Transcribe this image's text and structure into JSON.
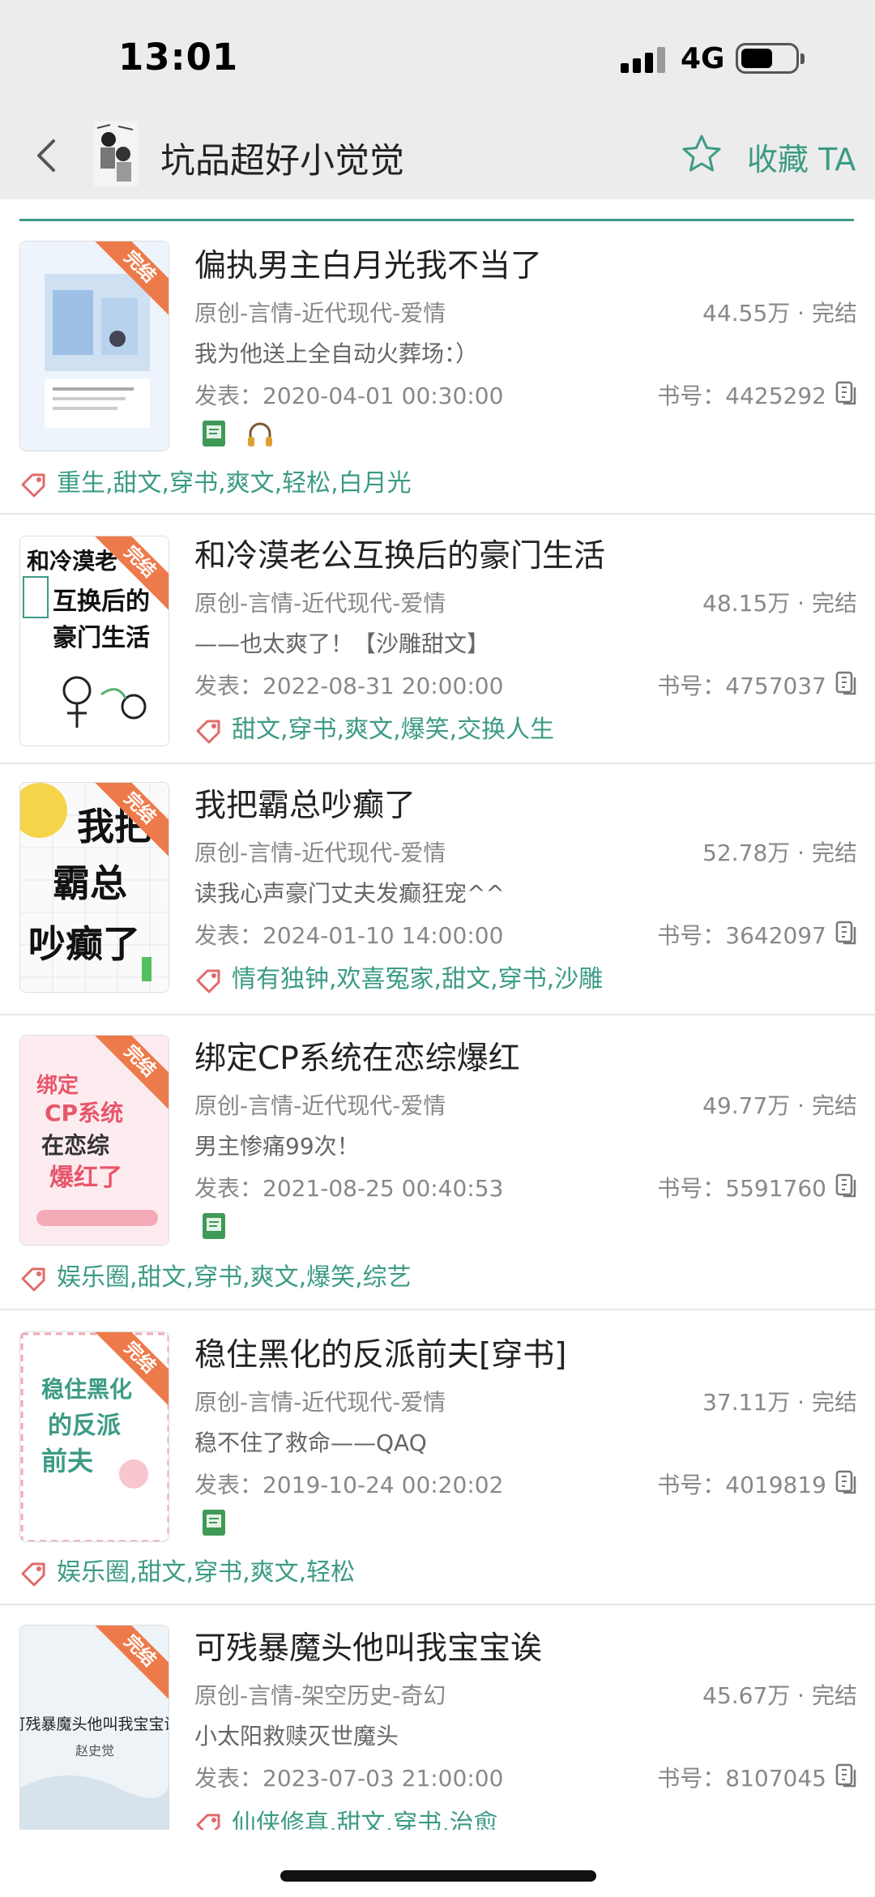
{
  "status_bar": {
    "time": "13:01",
    "network": "4G"
  },
  "header": {
    "title": "坑品超好小觉觉",
    "favorite_label": "收藏 TA"
  },
  "colors": {
    "accent": "#3c9b85",
    "ribbon": "#ed7a4a"
  },
  "books": [
    {
      "ribbon": "完结",
      "title": "偏执男主白月光我不当了",
      "genre": "原创-言情-近代现代-爱情",
      "words": "44.55万 · 完结",
      "desc": "我为他送上全自动火葬场：）",
      "publish": "发表：2020-04-01 00:30:00",
      "book_no": "书号：4425292",
      "badges": [
        "book-icon",
        "headphones-icon"
      ],
      "tags": "重生,甜文,穿书,爽文,轻松,白月光"
    },
    {
      "ribbon": "完结",
      "title": "和冷漠老公互换后的豪门生活",
      "genre": "原创-言情-近代现代-爱情",
      "words": "48.15万 · 完结",
      "desc": "——也太爽了！【沙雕甜文】",
      "publish": "发表：2022-08-31 20:00:00",
      "book_no": "书号：4757037",
      "badges": [],
      "tags": "甜文,穿书,爽文,爆笑,交换人生"
    },
    {
      "ribbon": "完结",
      "title": "我把霸总吵癫了",
      "genre": "原创-言情-近代现代-爱情",
      "words": "52.78万 · 完结",
      "desc": "读我心声豪门丈夫发癫狂宠^^",
      "publish": "发表：2024-01-10 14:00:00",
      "book_no": "书号：3642097",
      "badges": [],
      "tags": "情有独钟,欢喜冤家,甜文,穿书,沙雕"
    },
    {
      "ribbon": "完结",
      "title": "绑定CP系统在恋综爆红",
      "genre": "原创-言情-近代现代-爱情",
      "words": "49.77万 · 完结",
      "desc": "男主惨痛99次！",
      "publish": "发表：2021-08-25 00:40:53",
      "book_no": "书号：5591760",
      "badges": [
        "book-icon"
      ],
      "tags": "娱乐圈,甜文,穿书,爽文,爆笑,综艺"
    },
    {
      "ribbon": "完结",
      "title": "稳住黑化的反派前夫[穿书]",
      "genre": "原创-言情-近代现代-爱情",
      "words": "37.11万 · 完结",
      "desc": "稳不住了救命——QAQ",
      "publish": "发表：2019-10-24 00:20:02",
      "book_no": "书号：4019819",
      "badges": [
        "book-icon"
      ],
      "tags": "娱乐圈,甜文,穿书,爽文,轻松"
    },
    {
      "ribbon": "完结",
      "title": "可残暴魔头他叫我宝宝诶",
      "genre": "原创-言情-架空历史-奇幻",
      "words": "45.67万 · 完结",
      "desc": "小太阳救赎灭世魔头",
      "publish": "发表：2023-07-03 21:00:00",
      "book_no": "书号：8107045",
      "badges": [],
      "tags": "仙侠修真,甜文,穿书,治愈",
      "cover_text": "可残暴魔头他叫我宝宝诶",
      "cover_author": "赵史觉"
    }
  ]
}
